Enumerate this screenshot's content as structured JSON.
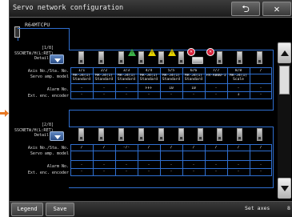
{
  "window": {
    "title": "Servo network configuration"
  },
  "toolbar": {
    "back_icon": "back-arrow-icon",
    "close_icon": "close-x-icon",
    "back_glyph": "⮌",
    "close_glyph": "✕"
  },
  "cpu": {
    "label": "R64MTCPU"
  },
  "row_labels": {
    "axis_sta": "Axis No./Sta. No.",
    "servo_amp_model": "Servo amp. model",
    "alarm_no": "Alarm No.",
    "ext_enc": "Ext. enc. encoder",
    "detail": "Detail"
  },
  "network1": {
    "page": "[1/8]",
    "label": "SSCNETⅢ/H(L:RET)",
    "axis_cells": [
      "1/1",
      "2/2",
      "3/3",
      "4/4",
      "5/5",
      "6/6",
      "7/7",
      "8/8",
      "/"
    ],
    "model_line1": [
      "MR-J4(1)",
      "MR-J4(1)",
      "MR-J4(1)",
      "MR-J4(1)",
      "MR-J4(1)",
      "MR-J4(1)",
      "FR-A800-1",
      "MR-J4(1)",
      ""
    ],
    "model_line2": [
      "Standard",
      "Standard",
      "Standard",
      "Standard",
      "Standard",
      "Standard",
      "",
      "Scale",
      ""
    ],
    "alarm_cells": [
      "-",
      "-",
      "-",
      "FFF",
      "10",
      "10",
      "-",
      "-",
      "-"
    ],
    "enc_cells": [
      "-",
      "-",
      "-",
      "-",
      "-",
      "-",
      "-",
      "1",
      "-"
    ]
  },
  "network2": {
    "page": "[2/8]",
    "label": "SSCNETⅢ/H(L:RET)",
    "axis_cells": [
      "/",
      "/",
      "-/-",
      "/",
      "/",
      "/",
      "/",
      "/",
      "/"
    ],
    "model_cells": [
      "",
      "",
      "",
      "",
      "",
      "",
      "",
      "",
      ""
    ],
    "alarm_cells": [
      "-",
      "-",
      "-",
      "-",
      "-",
      "-",
      "-",
      "-",
      "-"
    ],
    "enc_cells": [
      "-",
      "-",
      "-",
      "-",
      "-",
      "-",
      "-",
      "-",
      "-"
    ]
  },
  "status_icons": {
    "warn": "!",
    "error": "✕"
  },
  "bottom": {
    "legend_label": "Legend",
    "save_label": "Save",
    "set_axes_label": "Set axes",
    "set_axes_value": "8"
  },
  "colors": {
    "link": "#2f6fd0",
    "warn": "#e6d300",
    "error": "#d9233c",
    "ok": "#3cb34a",
    "arrow": "#e87722"
  }
}
